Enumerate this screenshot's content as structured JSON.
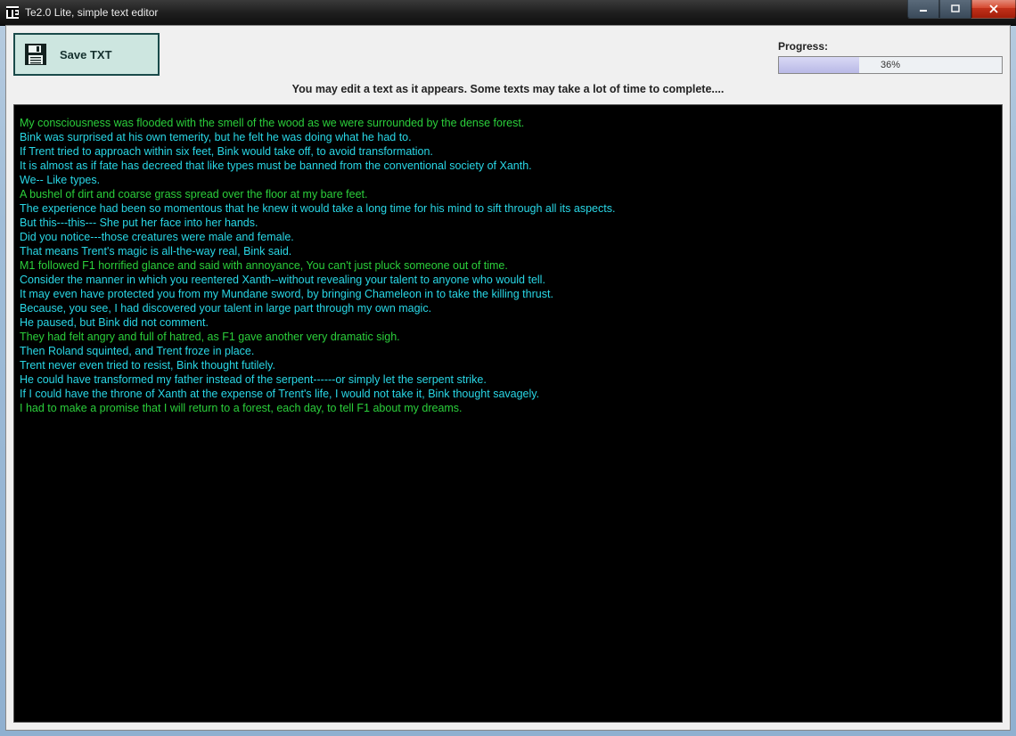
{
  "window": {
    "title": "Te2.0 Lite, simple text editor"
  },
  "toolbar": {
    "save_label": "Save TXT"
  },
  "progress": {
    "label": "Progress:",
    "percent": 36,
    "text": "36%"
  },
  "instruction": "You may edit a text as it appears. Some texts may take a lot of time to complete....",
  "editor_lines": [
    {
      "text": "My consciousness was flooded with the smell of the wood as we were surrounded by the dense forest.",
      "color": "green"
    },
    {
      "text": "Bink was surprised at his own temerity, but he felt he was doing what he had to.",
      "color": "cyan"
    },
    {
      "text": "If Trent tried to approach within six feet, Bink would take off, to avoid transformation.",
      "color": "cyan"
    },
    {
      "text": "It is almost as if fate has decreed that like types must be banned from the conventional society of Xanth.",
      "color": "cyan"
    },
    {
      "text": "We-- Like types.",
      "color": "cyan"
    },
    {
      "text": "A bushel of dirt and coarse grass spread over the floor at my bare feet.",
      "color": "green"
    },
    {
      "text": "The experience had been so momentous that he knew it would take a long time for his mind to sift through all its aspects.",
      "color": "cyan"
    },
    {
      "text": "But this---this--- She put her face into her hands.",
      "color": "cyan"
    },
    {
      "text": "Did you notice---those creatures were male and female.",
      "color": "cyan"
    },
    {
      "text": "That means Trent's magic is all-the-way real, Bink said.",
      "color": "cyan"
    },
    {
      "text": "M1 followed F1 horrified glance and said with annoyance, You can't just pluck someone out of time.",
      "color": "green"
    },
    {
      "text": "Consider the manner in which you reentered Xanth--without revealing your talent to anyone who would tell.",
      "color": "cyan"
    },
    {
      "text": "It may even have protected you from my Mundane sword, by bringing Chameleon in to take the killing thrust.",
      "color": "cyan"
    },
    {
      "text": "Because, you see, I had discovered your talent in large part through my own magic.",
      "color": "cyan"
    },
    {
      "text": "He paused, but Bink did not comment.",
      "color": "cyan"
    },
    {
      "text": "They had felt angry and full of hatred, as F1 gave another very dramatic sigh.",
      "color": "green"
    },
    {
      "text": "Then Roland squinted, and Trent froze in place.",
      "color": "cyan"
    },
    {
      "text": "Trent never even tried to resist, Bink thought futilely.",
      "color": "cyan"
    },
    {
      "text": "He could have transformed my father instead of the serpent------or simply let the serpent strike.",
      "color": "cyan"
    },
    {
      "text": "If I could have the throne of Xanth at the expense of Trent's life, I would not take it, Bink thought savagely.",
      "color": "cyan"
    },
    {
      "text": "I had to make a promise that I will return to a forest, each day, to tell F1 about my dreams.",
      "color": "green"
    }
  ]
}
